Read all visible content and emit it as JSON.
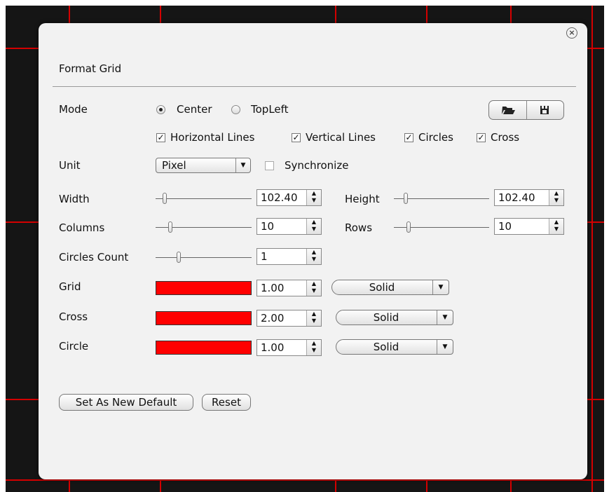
{
  "dialog": {
    "title": "Format Grid",
    "close_icon": "close-circle-icon"
  },
  "mode": {
    "label": "Mode",
    "options": [
      {
        "label": "Center",
        "selected": true
      },
      {
        "label": "TopLeft",
        "selected": false
      }
    ],
    "open_icon": "folder-open-icon",
    "save_icon": "save-disk-icon"
  },
  "lines": [
    {
      "label": "Horizontal Lines",
      "checked": true
    },
    {
      "label": "Vertical Lines",
      "checked": true
    },
    {
      "label": "Circles",
      "checked": true
    },
    {
      "label": "Cross",
      "checked": true
    }
  ],
  "unit": {
    "label": "Unit",
    "value": "Pixel",
    "synchronize_label": "Synchronize",
    "synchronize_checked": false
  },
  "width": {
    "label": "Width",
    "value": "102.40",
    "slider_level": 0.1
  },
  "height": {
    "label": "Height",
    "value": "102.40",
    "slider_level": 0.1
  },
  "columns": {
    "label": "Columns",
    "value": "10",
    "slider_level": 0.15
  },
  "rows": {
    "label": "Rows",
    "value": "10",
    "slider_level": 0.15
  },
  "circles_count": {
    "label": "Circles Count",
    "value": "1",
    "slider_level": 0.25
  },
  "styles": [
    {
      "label": "Grid",
      "color": "#ff0000",
      "width": "1.00",
      "line_style": "Solid"
    },
    {
      "label": "Cross",
      "color": "#ff0000",
      "width": "2.00",
      "line_style": "Solid"
    },
    {
      "label": "Circle",
      "color": "#ff0000",
      "width": "1.00",
      "line_style": "Solid"
    }
  ],
  "actions": {
    "set_default_label": "Set As New Default",
    "reset_label": "Reset"
  },
  "colors": {
    "grid_red": "#d40000",
    "dialog_bg": "#f2f2f2"
  }
}
